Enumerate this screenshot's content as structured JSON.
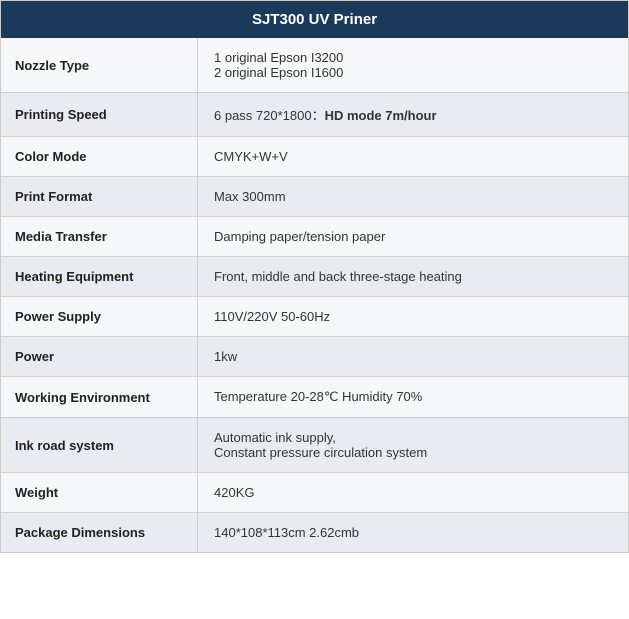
{
  "header": {
    "title": "SJT300 UV Priner"
  },
  "rows": [
    {
      "id": "nozzle-type",
      "label": "Nozzle Type",
      "value": "1 original Epson I3200\n2 original Epson I1600",
      "alt": false,
      "hasMultiLine": true,
      "line1": "1 original Epson I3200",
      "line2": "2 original Epson I1600"
    },
    {
      "id": "printing-speed",
      "label": "Printing Speed",
      "valuePrefix": "6 pass 720*1800：",
      "valueBold": "HD mode 7m/hour",
      "alt": true,
      "hasMixed": true
    },
    {
      "id": "color-mode",
      "label": "Color Mode",
      "value": "CMYK+W+V",
      "alt": false
    },
    {
      "id": "print-format",
      "label": "Print Format",
      "value": "Max 300mm",
      "alt": true
    },
    {
      "id": "media-transfer",
      "label": "Media Transfer",
      "value": "Damping paper/tension paper",
      "alt": false
    },
    {
      "id": "heating-equipment",
      "label": "Heating Equipment",
      "value": "Front, middle and back three-stage heating",
      "alt": true
    },
    {
      "id": "power-supply",
      "label": "Power Supply",
      "value": "110V/220V 50-60Hz",
      "alt": false
    },
    {
      "id": "power",
      "label": "Power",
      "value": "1kw",
      "alt": true
    },
    {
      "id": "working-environment",
      "label": "Working Environment",
      "value": "Temperature 20-28℃ Humidity 70%",
      "alt": false
    },
    {
      "id": "ink-road-system",
      "label": "Ink road system",
      "value": "Automatic ink supply,\nConstant pressure circulation system",
      "alt": true,
      "hasMultiLine": true,
      "line1": "Automatic ink supply,",
      "line2": "Constant pressure circulation system"
    },
    {
      "id": "weight",
      "label": "Weight",
      "value": "420KG",
      "alt": false
    },
    {
      "id": "package-dimensions",
      "label": "Package Dimensions",
      "value": "140*108*113cm 2.62cmb",
      "alt": true
    }
  ]
}
